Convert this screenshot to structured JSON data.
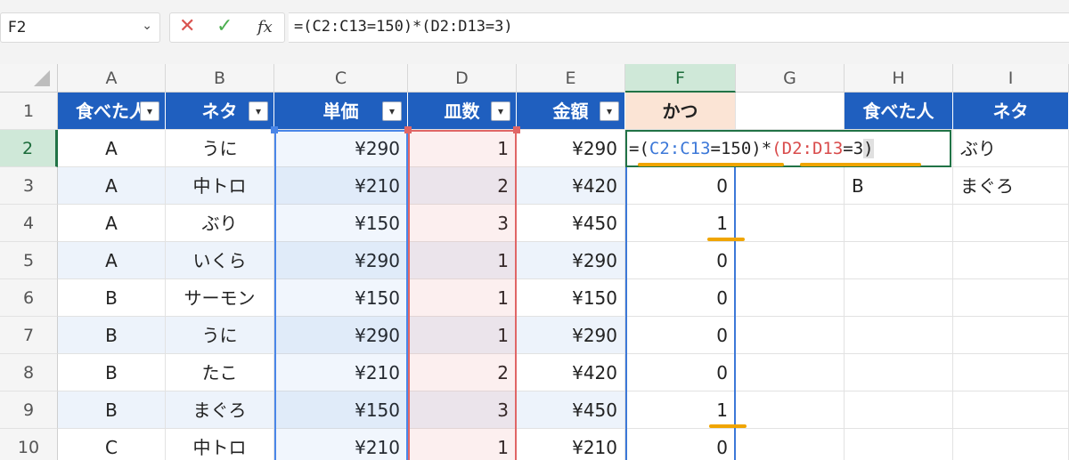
{
  "name_box": {
    "value": "F2",
    "dropdown_icon": "chevron-down-icon"
  },
  "formula_bar": {
    "cancel_icon": "close-icon",
    "enter_icon": "check-icon",
    "fx_label": "fx",
    "formula": "=(C2:C13=150)*(D2:D13=3)"
  },
  "columns": [
    "A",
    "B",
    "C",
    "D",
    "E",
    "F",
    "G",
    "H",
    "I"
  ],
  "rows": [
    "1",
    "2",
    "3",
    "4",
    "5",
    "6",
    "7",
    "8",
    "9",
    "10"
  ],
  "selected_column": "F",
  "selected_row": "2",
  "table_headers": {
    "a": "食べた人",
    "b": "ネタ",
    "c": "単価",
    "d": "皿数",
    "e": "金額",
    "f": "かつ",
    "h": "食べた人",
    "i": "ネタ"
  },
  "table_rows": [
    {
      "a": "A",
      "b": "うに",
      "c": "¥290",
      "d": "1",
      "e": "¥290",
      "f": "",
      "h": "",
      "i": "ぶり"
    },
    {
      "a": "A",
      "b": "中トロ",
      "c": "¥210",
      "d": "2",
      "e": "¥420",
      "f": "0",
      "h": "B",
      "i": "まぐろ"
    },
    {
      "a": "A",
      "b": "ぶり",
      "c": "¥150",
      "d": "3",
      "e": "¥450",
      "f": "1",
      "h": "",
      "i": ""
    },
    {
      "a": "A",
      "b": "いくら",
      "c": "¥290",
      "d": "1",
      "e": "¥290",
      "f": "0",
      "h": "",
      "i": ""
    },
    {
      "a": "B",
      "b": "サーモン",
      "c": "¥150",
      "d": "1",
      "e": "¥150",
      "f": "0",
      "h": "",
      "i": ""
    },
    {
      "a": "B",
      "b": "うに",
      "c": "¥290",
      "d": "1",
      "e": "¥290",
      "f": "0",
      "h": "",
      "i": ""
    },
    {
      "a": "B",
      "b": "たこ",
      "c": "¥210",
      "d": "2",
      "e": "¥420",
      "f": "0",
      "h": "",
      "i": ""
    },
    {
      "a": "B",
      "b": "まぐろ",
      "c": "¥150",
      "d": "3",
      "e": "¥450",
      "f": "1",
      "h": "",
      "i": ""
    },
    {
      "a": "C",
      "b": "中トロ",
      "c": "¥210",
      "d": "1",
      "e": "¥210",
      "f": "0",
      "h": "",
      "i": ""
    }
  ],
  "in_cell_formula": {
    "p1": "=(",
    "range1": "C2:C13",
    "p2": "=150)*",
    "p3": "(",
    "range2": "D2:D13",
    "p4": "=3",
    "p5": ")"
  },
  "colors": {
    "header_blue": "#1f5fbf",
    "highlight_header": "#fbe4d5",
    "range_c": "#4a86e8",
    "range_d": "#e06666",
    "active_border": "#217346",
    "underline": "#f0a500"
  }
}
